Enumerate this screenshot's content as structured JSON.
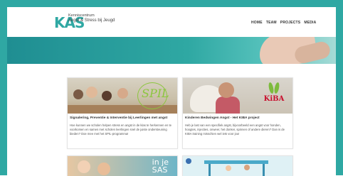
{
  "header": {
    "logo_mark": "KAS",
    "logo_line1": "Kenniscentrum",
    "logo_line2": "Angst & Stress bij Jeugd"
  },
  "nav": {
    "items": [
      "HOME",
      "TEAM",
      "PROJECTS",
      "MEDIA"
    ]
  },
  "cards": [
    {
      "title": "Signalering, Preventie & Interventie bij Leerlingen met angst",
      "description": "Hoe kunnen we scholen helpen stress en angst in de klas te herkennen en te voorkomen en samen met scholen leerlingen snel de juiste ondersteuning bieden? Doe mee met het SPIL-programma!",
      "image_text": "SPIL"
    },
    {
      "title": "Kinderen Bedwingen Angst - Het KIBA project",
      "description": "Heb je last van een specifiek angst, bijvoorbeeld een angst voor honden, hoogtes, injecties, onweer, het donker, spinnen of andere dieren? Dan is de KIBA training misschien wel iets voor jou!",
      "image_text": "KiBA"
    },
    {
      "title": "",
      "description": "",
      "image_text": "in je\nSAS"
    },
    {
      "title": "",
      "description": "",
      "image_text": ""
    }
  ],
  "colors": {
    "brand_teal": "#2fa8a3",
    "brand_green": "#8cc63f",
    "kiba_red": "#c8102e"
  }
}
